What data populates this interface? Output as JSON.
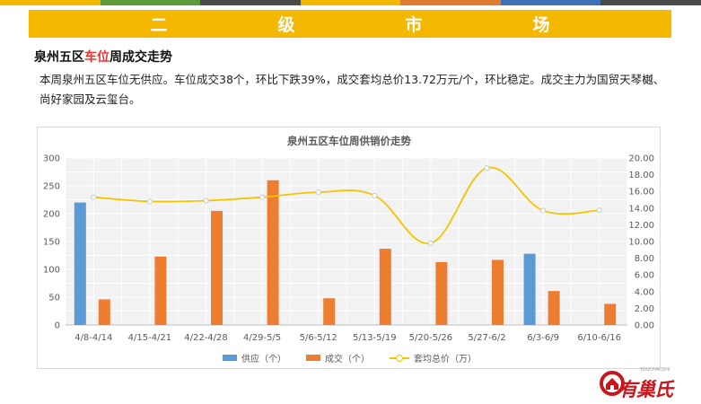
{
  "banner": {
    "title": "二　级　市　场"
  },
  "heading": {
    "prefix": "泉州五区",
    "highlight": "车位",
    "suffix": "周成交走势",
    "highlight_color": "#e8322a"
  },
  "paragraph": "本周泉州五区车位无供应。车位成交38个，环比下跌39%，成交套均总价13.72万元/个，环比稳定。成交主力为国贸天琴樾、尚好家园及云玺台。",
  "top_strip_colors": [
    "#f5b800",
    "#5b9b3a",
    "#4a4a4a",
    "#f5b800",
    "#e07a2e",
    "#3f6fb5",
    "#4a4a4a"
  ],
  "logo": {
    "name": "有巢氏",
    "sub": "YOUCHAOSHI",
    "color": "#c8161d"
  },
  "chart_data": {
    "type": "bar",
    "title": "泉州五区车位周供销价走势",
    "categories": [
      "4/8-4/14",
      "4/15-4/21",
      "4/22-4/28",
      "4/29-5/5",
      "5/6-5/12",
      "5/13-5/19",
      "5/20-5/26",
      "5/27-6/2",
      "6/3-6/9",
      "6/10-6/16"
    ],
    "series": [
      {
        "name": "供应（个）",
        "kind": "bar",
        "axis": "left",
        "color": "#5b9bd5",
        "values": [
          220,
          null,
          null,
          null,
          null,
          null,
          null,
          null,
          128,
          null
        ]
      },
      {
        "name": "成交（个）",
        "kind": "bar",
        "axis": "left",
        "color": "#ed7d31",
        "values": [
          46,
          123,
          205,
          260,
          48,
          137,
          113,
          117,
          61,
          38
        ]
      },
      {
        "name": "套均总价（万）",
        "kind": "line",
        "axis": "right",
        "color": "#f5c400",
        "values": [
          15.3,
          14.8,
          14.9,
          15.3,
          15.9,
          15.5,
          9.8,
          18.8,
          13.7,
          13.72
        ]
      }
    ],
    "left_axis": {
      "min": 0,
      "max": 300,
      "step": 50,
      "ticks": [
        "0",
        "50",
        "100",
        "150",
        "200",
        "250",
        "300"
      ]
    },
    "right_axis": {
      "min": 0,
      "max": 20,
      "step": 2,
      "ticks": [
        "0.00",
        "2.00",
        "4.00",
        "6.00",
        "8.00",
        "10.00",
        "12.00",
        "14.00",
        "16.00",
        "18.00",
        "20.00"
      ]
    },
    "grid": true,
    "legend": "bottom"
  }
}
